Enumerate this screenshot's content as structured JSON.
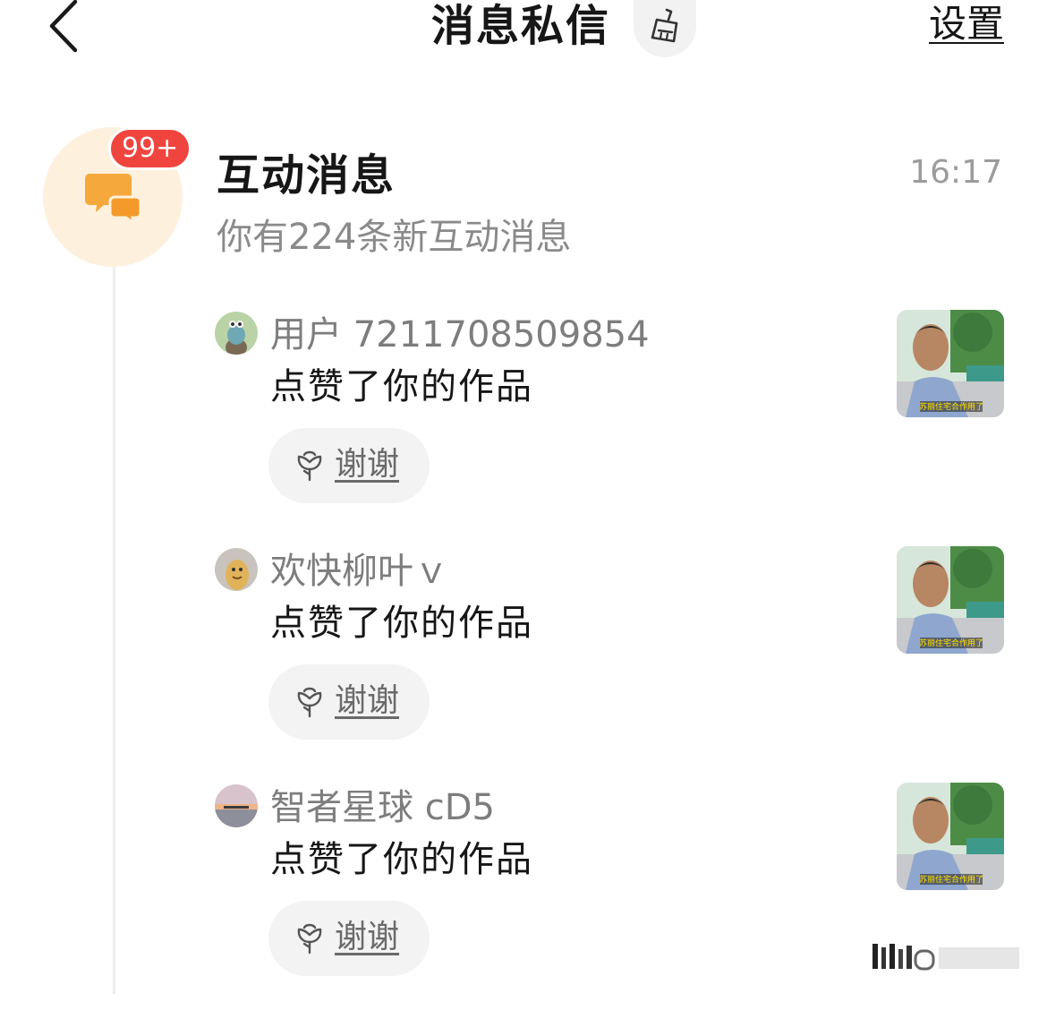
{
  "header": {
    "title": "消息私信",
    "settings_label": "设置",
    "back_icon": "chevron-left-icon",
    "clean_icon": "broom-icon"
  },
  "main_entry": {
    "icon": "chat-bubbles-icon",
    "badge": "99+",
    "title": "互动消息",
    "time": "16:17",
    "subtitle": "你有224条新互动消息",
    "icon_color": "#f5a93c",
    "badge_color": "#f0453f"
  },
  "items": [
    {
      "username": "用户 7211708509854",
      "action": "点赞了你的作品",
      "thanks_label": "谢谢"
    },
    {
      "username": "欢快柳叶ｖ",
      "action": "点赞了你的作品",
      "thanks_label": "谢谢"
    },
    {
      "username": "智者星球 cD5",
      "action": "点赞了你的作品",
      "thanks_label": "谢谢"
    }
  ],
  "thumbnail_caption": "苏丽住宅合作用了"
}
